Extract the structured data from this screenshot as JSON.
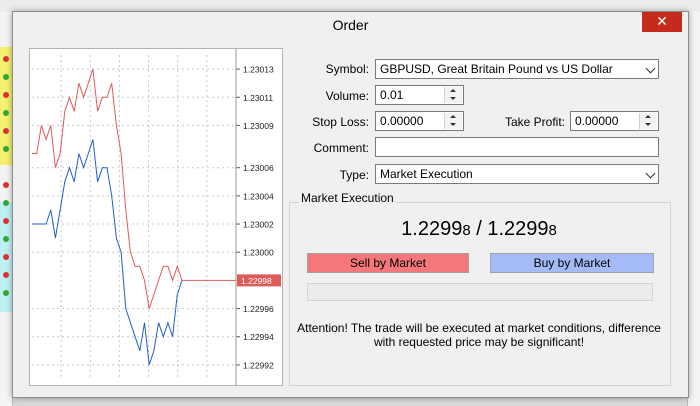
{
  "dialog": {
    "title": "Order",
    "close_label": "✕"
  },
  "chart_data": {
    "type": "line",
    "ylim": [
      1.22991,
      1.23014
    ],
    "y_ticks": [
      "1.23013",
      "1.23011",
      "1.23009",
      "1.23006",
      "1.23004",
      "1.23002",
      "1.23000",
      "1.22996",
      "1.22994",
      "1.22992"
    ],
    "current_price_label": "1.22998",
    "series": [
      {
        "values": [
          1.23007,
          1.23007,
          1.23009,
          1.23008,
          1.23009,
          1.23006,
          1.23007,
          1.2301,
          1.23011,
          1.2301,
          1.23012,
          1.23011,
          1.23012,
          1.23013,
          1.2301,
          1.23011,
          1.23011,
          1.23012,
          1.23009,
          1.23007,
          1.23003,
          1.23,
          1.22999,
          1.22999,
          1.22998,
          1.22996,
          1.22997,
          1.22998,
          1.22999,
          1.22999,
          1.22998,
          1.22999,
          1.22998
        ]
      },
      {
        "values": [
          1.23002,
          1.23002,
          1.23002,
          1.23002,
          1.23003,
          1.23001,
          1.23003,
          1.23005,
          1.23006,
          1.23005,
          1.23007,
          1.23006,
          1.23007,
          1.23008,
          1.23005,
          1.23006,
          1.23006,
          1.23004,
          1.23001,
          1.23,
          1.22996,
          1.22995,
          1.22994,
          1.22993,
          1.22995,
          1.22992,
          1.22993,
          1.22995,
          1.22994,
          1.22995,
          1.22994,
          1.22997,
          1.22998
        ]
      }
    ]
  },
  "form": {
    "symbol_label": "Symbol:",
    "symbol_value": "GBPUSD, Great Britain Pound vs US Dollar",
    "volume_label": "Volume:",
    "volume_value": "0.01",
    "stop_loss_label": "Stop Loss:",
    "stop_loss_value": "0.00000",
    "take_profit_label": "Take Profit:",
    "take_profit_value": "0.00000",
    "comment_label": "Comment:",
    "comment_value": "",
    "type_label": "Type:",
    "type_value": "Market Execution"
  },
  "market": {
    "group_title": "Market Execution",
    "bid_main": "1.2299",
    "bid_small": "8",
    "separator": " / ",
    "ask_main": "1.2299",
    "ask_small": "8",
    "sell_label": "Sell by Market",
    "buy_label": "Buy by Market",
    "attention": "Attention! The trade will be executed at market conditions, difference with requested price may be significant!"
  },
  "colors": {
    "sell": "#f4787b",
    "buy": "#a4bbf7",
    "series_bid": "#e05a5a",
    "series_ask": "#1f5fc9",
    "close": "#c42b1c"
  }
}
